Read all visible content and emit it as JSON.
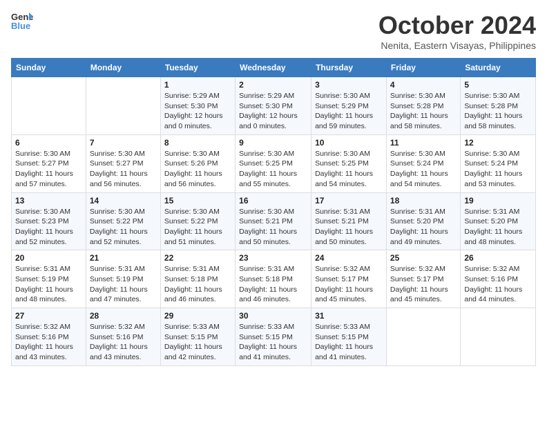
{
  "header": {
    "logo_line1": "General",
    "logo_line2": "Blue",
    "month": "October 2024",
    "location": "Nenita, Eastern Visayas, Philippines"
  },
  "weekdays": [
    "Sunday",
    "Monday",
    "Tuesday",
    "Wednesday",
    "Thursday",
    "Friday",
    "Saturday"
  ],
  "weeks": [
    [
      {
        "day": "",
        "info": ""
      },
      {
        "day": "",
        "info": ""
      },
      {
        "day": "1",
        "info": "Sunrise: 5:29 AM\nSunset: 5:30 PM\nDaylight: 12 hours\nand 0 minutes."
      },
      {
        "day": "2",
        "info": "Sunrise: 5:29 AM\nSunset: 5:30 PM\nDaylight: 12 hours\nand 0 minutes."
      },
      {
        "day": "3",
        "info": "Sunrise: 5:30 AM\nSunset: 5:29 PM\nDaylight: 11 hours\nand 59 minutes."
      },
      {
        "day": "4",
        "info": "Sunrise: 5:30 AM\nSunset: 5:28 PM\nDaylight: 11 hours\nand 58 minutes."
      },
      {
        "day": "5",
        "info": "Sunrise: 5:30 AM\nSunset: 5:28 PM\nDaylight: 11 hours\nand 58 minutes."
      }
    ],
    [
      {
        "day": "6",
        "info": "Sunrise: 5:30 AM\nSunset: 5:27 PM\nDaylight: 11 hours\nand 57 minutes."
      },
      {
        "day": "7",
        "info": "Sunrise: 5:30 AM\nSunset: 5:27 PM\nDaylight: 11 hours\nand 56 minutes."
      },
      {
        "day": "8",
        "info": "Sunrise: 5:30 AM\nSunset: 5:26 PM\nDaylight: 11 hours\nand 56 minutes."
      },
      {
        "day": "9",
        "info": "Sunrise: 5:30 AM\nSunset: 5:25 PM\nDaylight: 11 hours\nand 55 minutes."
      },
      {
        "day": "10",
        "info": "Sunrise: 5:30 AM\nSunset: 5:25 PM\nDaylight: 11 hours\nand 54 minutes."
      },
      {
        "day": "11",
        "info": "Sunrise: 5:30 AM\nSunset: 5:24 PM\nDaylight: 11 hours\nand 54 minutes."
      },
      {
        "day": "12",
        "info": "Sunrise: 5:30 AM\nSunset: 5:24 PM\nDaylight: 11 hours\nand 53 minutes."
      }
    ],
    [
      {
        "day": "13",
        "info": "Sunrise: 5:30 AM\nSunset: 5:23 PM\nDaylight: 11 hours\nand 52 minutes."
      },
      {
        "day": "14",
        "info": "Sunrise: 5:30 AM\nSunset: 5:22 PM\nDaylight: 11 hours\nand 52 minutes."
      },
      {
        "day": "15",
        "info": "Sunrise: 5:30 AM\nSunset: 5:22 PM\nDaylight: 11 hours\nand 51 minutes."
      },
      {
        "day": "16",
        "info": "Sunrise: 5:30 AM\nSunset: 5:21 PM\nDaylight: 11 hours\nand 50 minutes."
      },
      {
        "day": "17",
        "info": "Sunrise: 5:31 AM\nSunset: 5:21 PM\nDaylight: 11 hours\nand 50 minutes."
      },
      {
        "day": "18",
        "info": "Sunrise: 5:31 AM\nSunset: 5:20 PM\nDaylight: 11 hours\nand 49 minutes."
      },
      {
        "day": "19",
        "info": "Sunrise: 5:31 AM\nSunset: 5:20 PM\nDaylight: 11 hours\nand 48 minutes."
      }
    ],
    [
      {
        "day": "20",
        "info": "Sunrise: 5:31 AM\nSunset: 5:19 PM\nDaylight: 11 hours\nand 48 minutes."
      },
      {
        "day": "21",
        "info": "Sunrise: 5:31 AM\nSunset: 5:19 PM\nDaylight: 11 hours\nand 47 minutes."
      },
      {
        "day": "22",
        "info": "Sunrise: 5:31 AM\nSunset: 5:18 PM\nDaylight: 11 hours\nand 46 minutes."
      },
      {
        "day": "23",
        "info": "Sunrise: 5:31 AM\nSunset: 5:18 PM\nDaylight: 11 hours\nand 46 minutes."
      },
      {
        "day": "24",
        "info": "Sunrise: 5:32 AM\nSunset: 5:17 PM\nDaylight: 11 hours\nand 45 minutes."
      },
      {
        "day": "25",
        "info": "Sunrise: 5:32 AM\nSunset: 5:17 PM\nDaylight: 11 hours\nand 45 minutes."
      },
      {
        "day": "26",
        "info": "Sunrise: 5:32 AM\nSunset: 5:16 PM\nDaylight: 11 hours\nand 44 minutes."
      }
    ],
    [
      {
        "day": "27",
        "info": "Sunrise: 5:32 AM\nSunset: 5:16 PM\nDaylight: 11 hours\nand 43 minutes."
      },
      {
        "day": "28",
        "info": "Sunrise: 5:32 AM\nSunset: 5:16 PM\nDaylight: 11 hours\nand 43 minutes."
      },
      {
        "day": "29",
        "info": "Sunrise: 5:33 AM\nSunset: 5:15 PM\nDaylight: 11 hours\nand 42 minutes."
      },
      {
        "day": "30",
        "info": "Sunrise: 5:33 AM\nSunset: 5:15 PM\nDaylight: 11 hours\nand 41 minutes."
      },
      {
        "day": "31",
        "info": "Sunrise: 5:33 AM\nSunset: 5:15 PM\nDaylight: 11 hours\nand 41 minutes."
      },
      {
        "day": "",
        "info": ""
      },
      {
        "day": "",
        "info": ""
      }
    ]
  ]
}
